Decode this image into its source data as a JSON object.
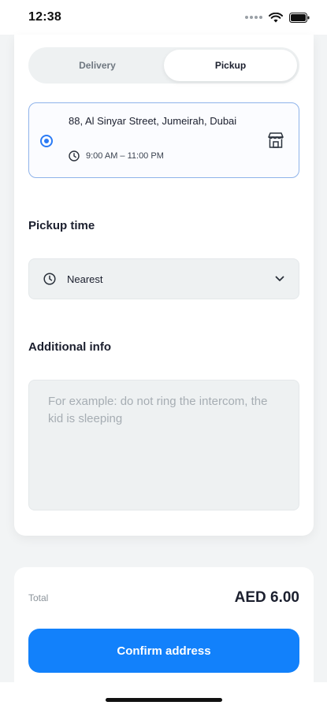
{
  "status_bar": {
    "time": "12:38"
  },
  "tabs": [
    {
      "label": "Delivery",
      "active": false
    },
    {
      "label": "Pickup",
      "active": true
    }
  ],
  "pickup_location": {
    "address": "88, Al Sinyar Street, Jumeirah, Dubai",
    "hours": "9:00 AM – 11:00 PM",
    "selected": true,
    "icon": "store-icon"
  },
  "pickup_time": {
    "title": "Pickup time",
    "value": "Nearest",
    "icon": "clock-icon"
  },
  "additional_info": {
    "title": "Additional info",
    "placeholder": "For example: do not ring the intercom, the kid is sleeping"
  },
  "footer": {
    "total_label": "Total",
    "total_value": "AED 6.00",
    "confirm_label": "Confirm address"
  },
  "colors": {
    "accent": "#1281fb",
    "selected_border": "#8fb3ea",
    "field_bg": "#eef1f2"
  }
}
